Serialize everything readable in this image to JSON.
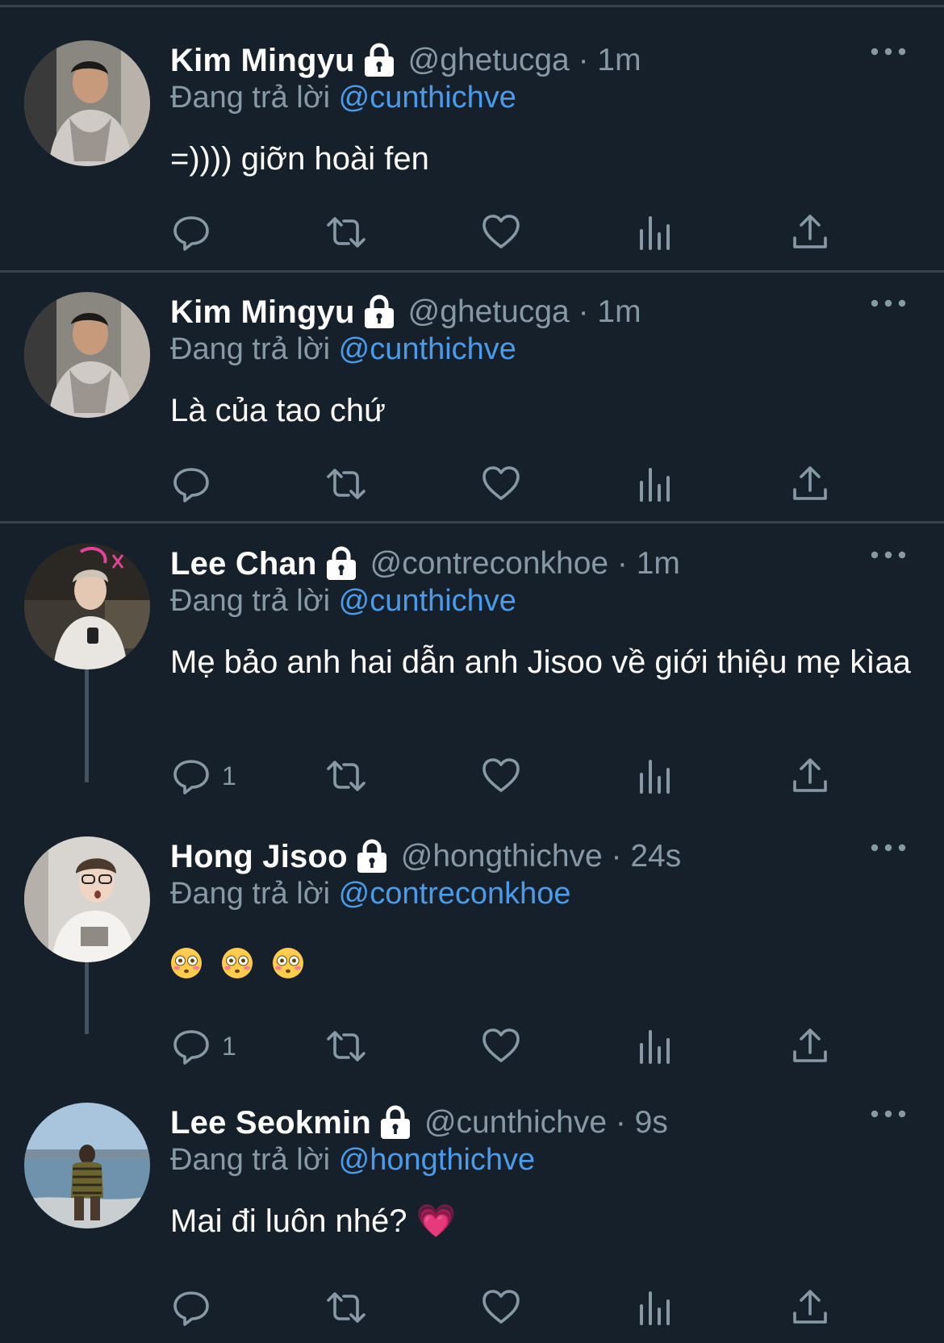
{
  "reply_prefix": "Đang trả lời",
  "tweets": [
    {
      "name": "Kim Mingyu",
      "handle_time": "@ghetucga · 1m",
      "replying_to": "@cunthichve",
      "text": "=)))) giỡn hoài fen",
      "reply_count": ""
    },
    {
      "name": "Kim Mingyu",
      "handle_time": "@ghetucga · 1m",
      "replying_to": "@cunthichve",
      "text": "Là của tao chứ",
      "reply_count": ""
    },
    {
      "name": "Lee Chan",
      "handle_time": "@contreconkhoe · 1m",
      "replying_to": "@cunthichve",
      "text": "Mẹ bảo anh hai dẫn anh Jisoo về giới thiệu mẹ kìaa",
      "reply_count": "1"
    },
    {
      "name": "Hong Jisoo",
      "handle_time": "@hongthichve · 24s",
      "replying_to": "@contreconkhoe",
      "text": "😳 😳 😳",
      "reply_count": "1"
    },
    {
      "name": "Lee Seokmin",
      "handle_time": "@cunthichve · 9s",
      "replying_to": "@hongthichve",
      "text": "Mai đi luôn nhé? 💗",
      "reply_count": ""
    }
  ],
  "icons": [
    "lock-icon",
    "more-icon",
    "reply-icon",
    "retweet-icon",
    "like-icon",
    "analytics-icon",
    "share-icon"
  ],
  "colors": {
    "background": "#16202b",
    "muted": "#8899a6",
    "link": "#4a9bea",
    "divider": "#38444d"
  }
}
